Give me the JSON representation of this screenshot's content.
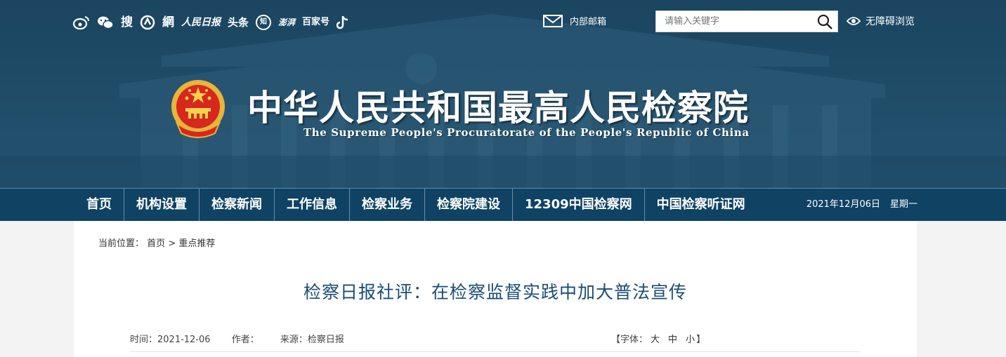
{
  "social": {
    "icons": [
      "weibo-icon",
      "wechat-icon",
      "sohu-icon",
      "netease-icon",
      "wangyi-icon",
      "peoples-daily-icon",
      "toutiao-icon",
      "zhihu-icon",
      "thepaper-icon",
      "baijiahao-icon",
      "douyin-icon"
    ],
    "labels": {
      "sou": "搜",
      "wang": "網",
      "renmin": "人民日报",
      "toutiao": "头条",
      "zhi": "知",
      "pengpai": "澎湃",
      "baijia": "百家号"
    }
  },
  "mail_label": "内部邮箱",
  "search": {
    "placeholder": "请输入关键字"
  },
  "accessibility_label": "无障碍浏览",
  "title_cn": "中华人民共和国最高人民检察院",
  "title_en": "The Supreme People's Procuratorate of the People's Republic of China",
  "nav": {
    "items": [
      "首页",
      "机构设置",
      "检察新闻",
      "工作信息",
      "检察业务",
      "检察院建设",
      "12309中国检察网",
      "中国检察听证网"
    ],
    "date": "2021年12月06日",
    "weekday": "星期一"
  },
  "breadcrumb": {
    "prefix": "当前位置：",
    "home": "首页",
    "sep": ">",
    "current": "重点推荐"
  },
  "article": {
    "title": "检察日报社评：在检察监督实践中加大普法宣传",
    "time": "时间：2021-12-06",
    "author": "作者：",
    "source": "来源：检察日报",
    "font_label": "【字体：",
    "font_large": "大",
    "font_medium": "中",
    "font_small": "小",
    "font_close": "】"
  },
  "colors": {
    "header_bg": "#1f4b68",
    "nav_bg": "#0f4263",
    "title_blue": "#1b4d74"
  }
}
